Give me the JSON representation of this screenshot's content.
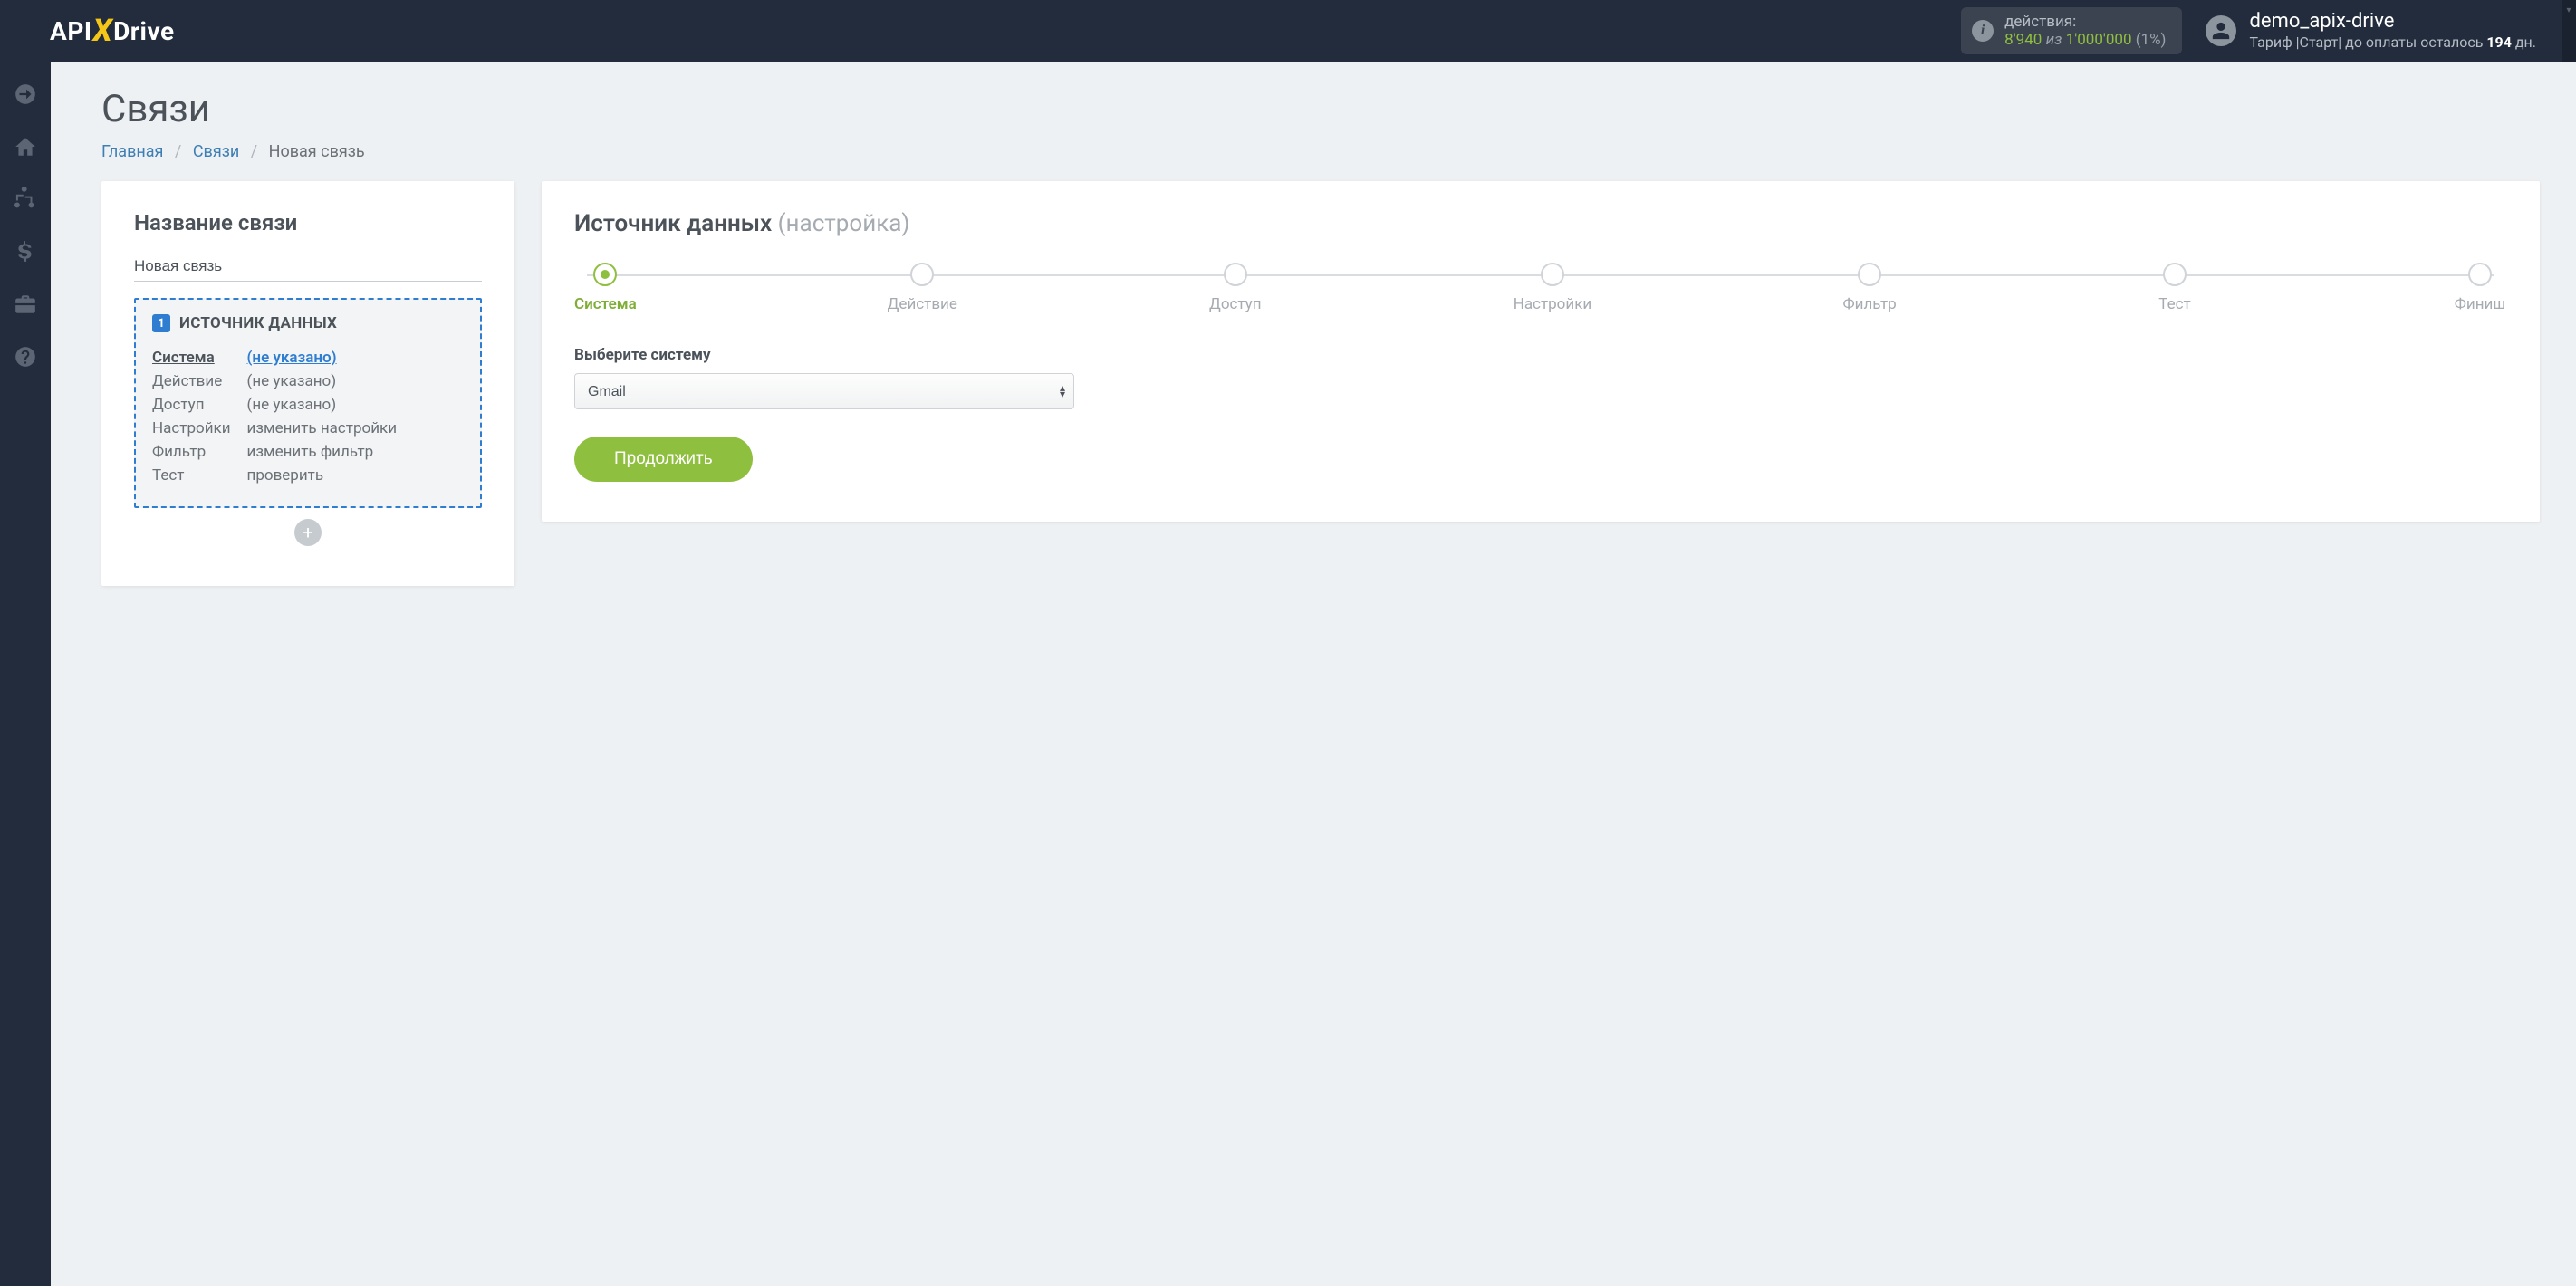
{
  "brand": {
    "p1": "API",
    "x": "X",
    "p2": "Drive"
  },
  "header": {
    "actions_label": "действия:",
    "actions_current": "8'940",
    "actions_iz": "из",
    "actions_max": "1'000'000",
    "actions_pct": "(1%)",
    "user_name": "demo_apix-drive",
    "plan_prefix": "Тариф |Старт| до оплаты осталось ",
    "plan_days": "194",
    "plan_suffix": " дн."
  },
  "page": {
    "title": "Связи"
  },
  "breadcrumb": {
    "home": "Главная",
    "links": "Связи",
    "current": "Новая связь"
  },
  "left_panel": {
    "title": "Название связи",
    "name_value": "Новая связь",
    "box_badge": "1",
    "box_title": "ИСТОЧНИК ДАННЫХ",
    "rows": [
      {
        "k": "Система",
        "v": "(не указано)",
        "active": true
      },
      {
        "k": "Действие",
        "v": "(не указано)"
      },
      {
        "k": "Доступ",
        "v": "(не указано)"
      },
      {
        "k": "Настройки",
        "v": "изменить настройки"
      },
      {
        "k": "Фильтр",
        "v": "изменить фильтр"
      },
      {
        "k": "Тест",
        "v": "проверить"
      }
    ],
    "add_label": "+"
  },
  "right_panel": {
    "title_main": "Источник данных",
    "title_muted": "(настройка)",
    "steps": [
      "Система",
      "Действие",
      "Доступ",
      "Настройки",
      "Фильтр",
      "Тест",
      "Финиш"
    ],
    "active_step_index": 0,
    "select_label": "Выберите систему",
    "select_value": "Gmail",
    "continue_label": "Продолжить"
  }
}
